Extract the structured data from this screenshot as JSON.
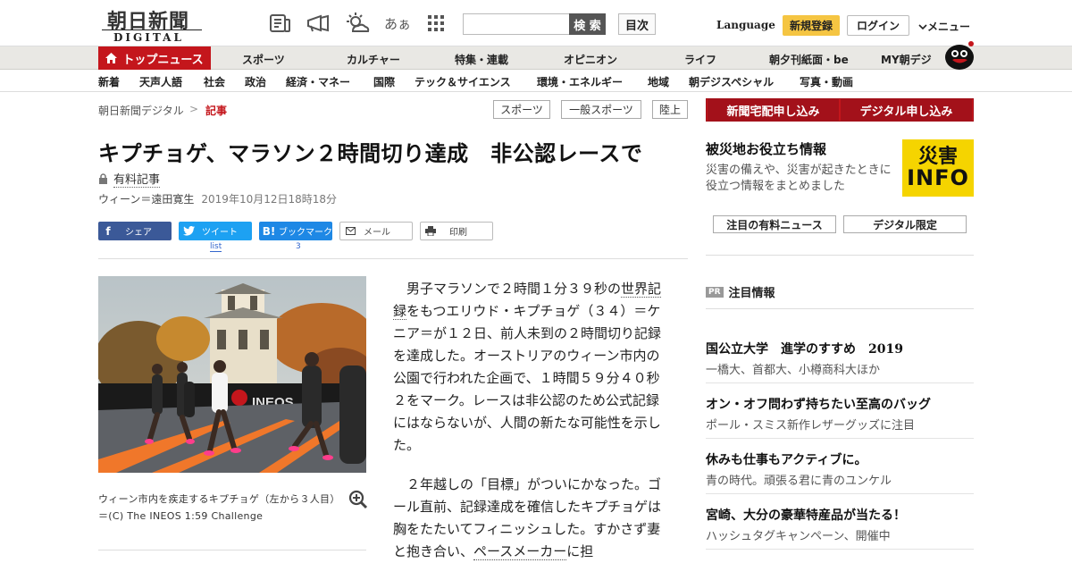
{
  "header": {
    "logo_jp": "朝日新聞",
    "logo_en": "DIGITAL",
    "icons": [
      "paper-icon",
      "megaphone-icon",
      "weather-icon",
      "font-size-icon",
      "grid-icon"
    ],
    "font_icon_text": "あぁ",
    "search_button": "検 索",
    "mokuji": "目次",
    "language": "Language",
    "register": "新規登録",
    "login": "ログイン",
    "menu": "メニュー"
  },
  "nav_primary": {
    "top_news": "トップニュース",
    "items": [
      "スポーツ",
      "カルチャー",
      "特集・連載",
      "オピニオン",
      "ライフ",
      "朝夕刊紙面・be",
      "MY朝デジ"
    ]
  },
  "nav_secondary": [
    "新着",
    "天声人語",
    "社会",
    "政治",
    "経済・マネー",
    "国際",
    "テック＆サイエンス",
    "環境・エネルギー",
    "地域",
    "朝デジスペシャル",
    "写真・動画"
  ],
  "breadcrumb": {
    "home": "朝日新聞デジタル",
    "sep": ">",
    "current": "記事"
  },
  "tags": [
    "スポーツ",
    "一般スポーツ",
    "陸上"
  ],
  "article": {
    "title": "キプチョゲ、マラソン２時間切り達成　非公認レースで",
    "paid": "有料記事",
    "byline": "ウィーン＝遠田寛生",
    "date": "2019年10月12日18時18分",
    "share": {
      "facebook": "シェア",
      "twitter": "ツイート",
      "hatena": "ブックマーク",
      "mail": "メール",
      "print": "印刷",
      "twitter_count": "list",
      "hatena_count": "3"
    },
    "caption": "ウィーン市内を疾走するキプチョゲ（左から３人目）＝(C) The INEOS 1:59 Challenge",
    "para1_a": "男子マラソンで２時間１分３９秒の",
    "para1_link": "世界記録",
    "para1_b": "をもつエリウド・キプチョゲ（３４）＝ケニア＝が１２日、前人未到の２時間切り記録を達成した。オーストリアのウィーン市内の公園で行われた企画で、１時間５９分４０秒２をマーク。レースは非公認のため公式記録にはならないが、人間の新たな可能性を示した。",
    "para2_a": "２年越しの「目標」がついにかなった。ゴール直前、記録達成を確信したキプチョゲは胸をたたいてフィニッシュした。すかさず妻と抱き合い、",
    "para2_link": "ペースメーカー",
    "para2_b": "に担"
  },
  "sidebar": {
    "subscribe_paper": "新聞宅配申し込み",
    "subscribe_digital": "デジタル申し込み",
    "disaster_title": "被災地お役立ち情報",
    "disaster_desc": "災害の備えや、災害が起きたときに役立つ情報をまとめました",
    "disaster_img_top": "災害",
    "disaster_img_bottom": "INFO",
    "btn_paid_news": "注目の有料ニュース",
    "btn_digital": "デジタル限定",
    "pr_badge": "PR",
    "pr_title": "注目情報",
    "ads": [
      {
        "title": "国公立大学　進学のすすめ　2019",
        "desc": "一橋大、首都大、小樽商科大ほか"
      },
      {
        "title": "オン・オフ問わず持ちたい至高のバッグ",
        "desc": "ポール・スミス新作レザーグッズに注目"
      },
      {
        "title": "休みも仕事もアクティブに。",
        "desc": "青の時代。頑張る君に青のユンケル"
      },
      {
        "title": "宮崎、大分の豪華特産品が当たる！",
        "desc": "ハッシュタグキャンペーン、開催中"
      }
    ]
  },
  "colors": {
    "brand_red": "#c4161c",
    "nav_bg": "#e9e8e4",
    "register_yellow": "#f5c542",
    "facebook": "#3b5998",
    "twitter": "#1da1f2",
    "hatena": "#1e88e5"
  }
}
